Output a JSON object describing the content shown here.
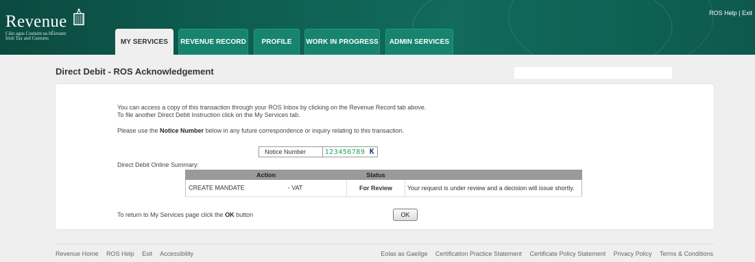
{
  "header": {
    "logo_text": "Revenue",
    "logo_sub_line1": "Cáin agus Custaim na hÉireann",
    "logo_sub_line2": "Irish Tax and Customs",
    "tabs": [
      {
        "label": "MY SERVICES",
        "active": true
      },
      {
        "label": "REVENUE RECORD",
        "active": false
      },
      {
        "label": "PROFILE",
        "active": false
      },
      {
        "label": "WORK IN PROGRESS",
        "active": false
      },
      {
        "label": "ADMIN SERVICES",
        "active": false
      }
    ],
    "ros_help_link": "ROS Help",
    "separator": "|",
    "exit_link": "Exit"
  },
  "page": {
    "title": "Direct Debit - ROS Acknowledgement"
  },
  "content": {
    "info_line1": "You can access a copy of this transaction through your ROS Inbox by clicking on the Revenue Record tab above.",
    "info_line2": "To file another Direct Debit Instruction click on the My Services tab.",
    "notice_prefix": "Please use the ",
    "notice_bold": "Notice Number",
    "notice_suffix": " below in any future correspondence or inquiry relating to this transaction.",
    "notice_label": "Notice Number",
    "notice_number": "123456789",
    "notice_check": "K",
    "summary_label": "Direct Debit Online Summary:",
    "table": {
      "headers": [
        "Action",
        "Status",
        ""
      ],
      "row": {
        "action_prefix": "CREATE MANDATE",
        "action_suffix": "- VAT",
        "status": "For Review",
        "description": "Your request is under review and a decision will issue shortly."
      }
    },
    "return_prefix": "To return to My Services page click the ",
    "return_bold": "OK",
    "return_suffix": " button",
    "ok_button": "OK"
  },
  "footer": {
    "left_links": [
      "Revenue Home",
      "ROS Help",
      "Exit",
      "Accessibility"
    ],
    "right_links": [
      "Eolas as Gaeilge",
      "Certification Practice Statement",
      "Certificate Policy Statement",
      "Privacy Policy",
      "Terms & Conditions"
    ]
  },
  "colors": {
    "header_green": "#0e5d50",
    "tab_green": "#17846f",
    "status_red": "#cc0000",
    "notice_green": "#1aa35a"
  }
}
